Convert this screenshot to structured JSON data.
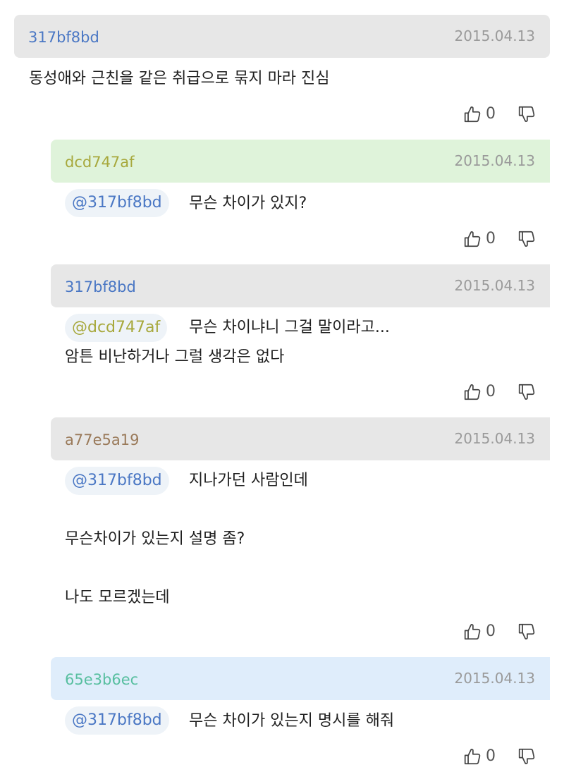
{
  "colors": {
    "header_gray": "#e7e7e7",
    "header_green": "#dff3da",
    "header_blue": "#dfedfb",
    "user_317bf8bd": "#4a77c4",
    "user_dcd747af": "#a7a83c",
    "user_a77e5a19": "#9a7a5a",
    "user_65e3b6ec": "#58bfa0",
    "mention_bg": "#eef3f8"
  },
  "comments": [
    {
      "username": "317bf8bd",
      "date": "2015.04.13",
      "text_lines": [
        "동성애와 근친을 같은 취급으로 묶지 마라 진심"
      ],
      "votes_up": "0"
    },
    {
      "username": "dcd747af",
      "date": "2015.04.13",
      "mention": "@317bf8bd",
      "text_lines": [
        "무슨 차이가 있지?"
      ],
      "votes_up": "0"
    },
    {
      "username": "317bf8bd",
      "date": "2015.04.13",
      "mention": "@dcd747af",
      "text_lines": [
        "무슨 차이냐니 그걸 말이라고...",
        "암튼 비난하거나 그럴 생각은 없다"
      ],
      "votes_up": "0"
    },
    {
      "username": "a77e5a19",
      "date": "2015.04.13",
      "mention": "@317bf8bd",
      "text_lines": [
        "지나가던 사람인데",
        "무슨차이가 있는지 설명 좀?",
        "나도 모르겠는데"
      ],
      "votes_up": "0"
    },
    {
      "username": "65e3b6ec",
      "date": "2015.04.13",
      "mention": "@317bf8bd",
      "text_lines": [
        "무슨 차이가 있는지 명시를 해줘"
      ],
      "votes_up": "0"
    }
  ]
}
